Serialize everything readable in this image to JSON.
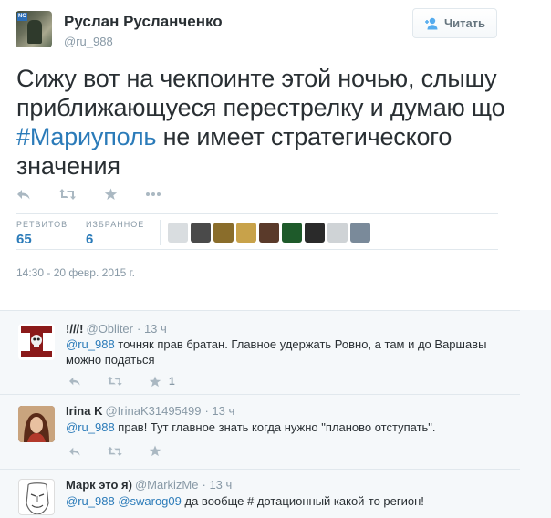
{
  "tweet": {
    "author_name": "Руслан Русланченко",
    "author_handle": "@ru_988",
    "avatar_badge": "NO",
    "follow_label": "Читать",
    "text_before": "Сижу вот на чекпоинте этой ночью, слышу приближающуеся перестрелку и думаю що ",
    "hashtag": "#Мариуполь",
    "text_after": " не имеет стратегического значения",
    "retweets_label": "РЕТВИТОВ",
    "retweets_count": "65",
    "favorites_label": "ИЗБРАННОЕ",
    "favorites_count": "6",
    "timestamp": "14:30 - 20 февр. 2015 г.",
    "favoriter_colors": [
      "#d9dde0",
      "#4a4a4a",
      "#8a6d2b",
      "#c8a24a",
      "#5a3a2a",
      "#1e5a2a",
      "#2a2a2a",
      "#cfd3d6",
      "#7a8a9a"
    ],
    "icons": {
      "reply": "reply-icon",
      "retweet": "retweet-icon",
      "favorite": "star-icon",
      "more": "more-icon",
      "follow": "add-user-icon"
    }
  },
  "replies": [
    {
      "name": "!///!",
      "handle": "@Obliter",
      "time": "· 13 ч",
      "mention": "@ru_988",
      "text": " точняк прав братан. Главное удержать Ровно, а там и до Варшавы можно податься",
      "fav_count": "1"
    },
    {
      "name": "Irina K",
      "handle": "@IrinaK31495499",
      "time": "· 13 ч",
      "mention": "@ru_988",
      "text": " прав! Тут главное знать когда нужно \"планово отступать\".",
      "fav_count": ""
    },
    {
      "name": "Марк это я)",
      "handle": "@MarkizMe",
      "time": "· 13 ч",
      "mention": "@ru_988",
      "mention2": "@swarog09",
      "text": " да вообще # дотационный какой-то регион!",
      "fav_count": ""
    }
  ]
}
